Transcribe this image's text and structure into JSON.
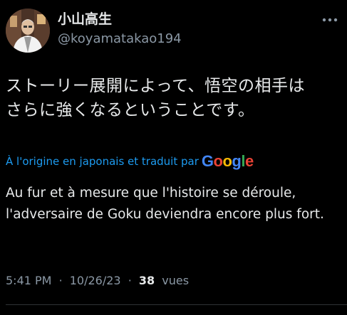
{
  "author": {
    "display_name": "小山高生",
    "handle": "@koyamatakao194",
    "avatar_icon": "profile-photo"
  },
  "tweet": {
    "text_line1": "ストーリー展開によって、悟空の相手は",
    "text_line2": "さらに強くなるということです。"
  },
  "translation": {
    "note": "À l'origine en japonais et traduit par",
    "provider": "Google",
    "provider_colors": [
      "#4285f4",
      "#ea4335",
      "#fbbc05",
      "#4285f4",
      "#34a853",
      "#ea4335"
    ],
    "text": "Au fur et à mesure que l'histoire se déroule, l'adversaire de Goku deviendra encore plus fort."
  },
  "meta": {
    "time": "5:41 PM",
    "separator": "·",
    "date": "10/26/23",
    "views_count": "38",
    "views_label": "vues"
  },
  "colors": {
    "background": "#000000",
    "text_primary": "#e7e9ea",
    "text_secondary": "#8b98a5",
    "link": "#1d9bf0",
    "divider": "#2f3336"
  }
}
